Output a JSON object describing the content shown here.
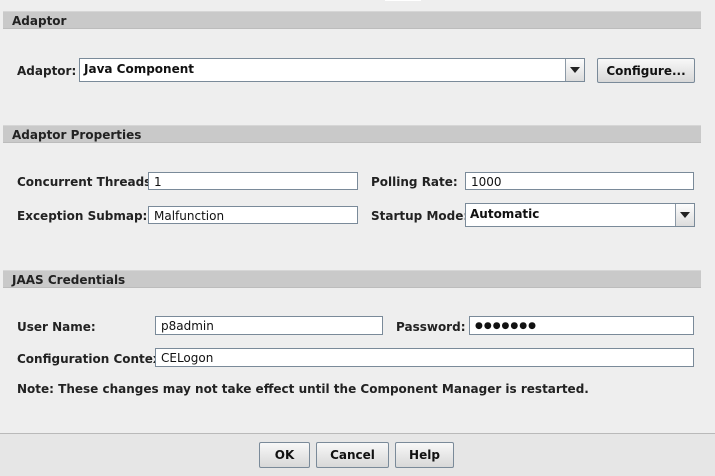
{
  "sections": {
    "adaptor": "Adaptor",
    "adaptor_properties": "Adaptor Properties",
    "jaas": "JAAS Credentials"
  },
  "adaptor": {
    "label": "Adaptor:",
    "value": "Java Component",
    "configure_label": "Configure..."
  },
  "properties": {
    "concurrent_threads_label": "Concurrent Threads:",
    "concurrent_threads_value": "1",
    "polling_rate_label": "Polling Rate:",
    "polling_rate_value": "1000",
    "exception_submap_label": "Exception Submap:",
    "exception_submap_value": "Malfunction",
    "startup_mode_label": "Startup Mode:",
    "startup_mode_value": "Automatic"
  },
  "jaas": {
    "user_name_label": "User Name:",
    "user_name_value": "p8admin",
    "password_label": "Password:",
    "password_value": "●●●●●●●",
    "config_context_label": "Configuration Context:",
    "config_context_value": "CELogon"
  },
  "note": "Note: These changes may not take effect until the Component Manager is restarted.",
  "buttons": {
    "ok": "OK",
    "cancel": "Cancel",
    "help": "Help"
  },
  "icons": {
    "dropdown": "chevron-down-icon"
  }
}
